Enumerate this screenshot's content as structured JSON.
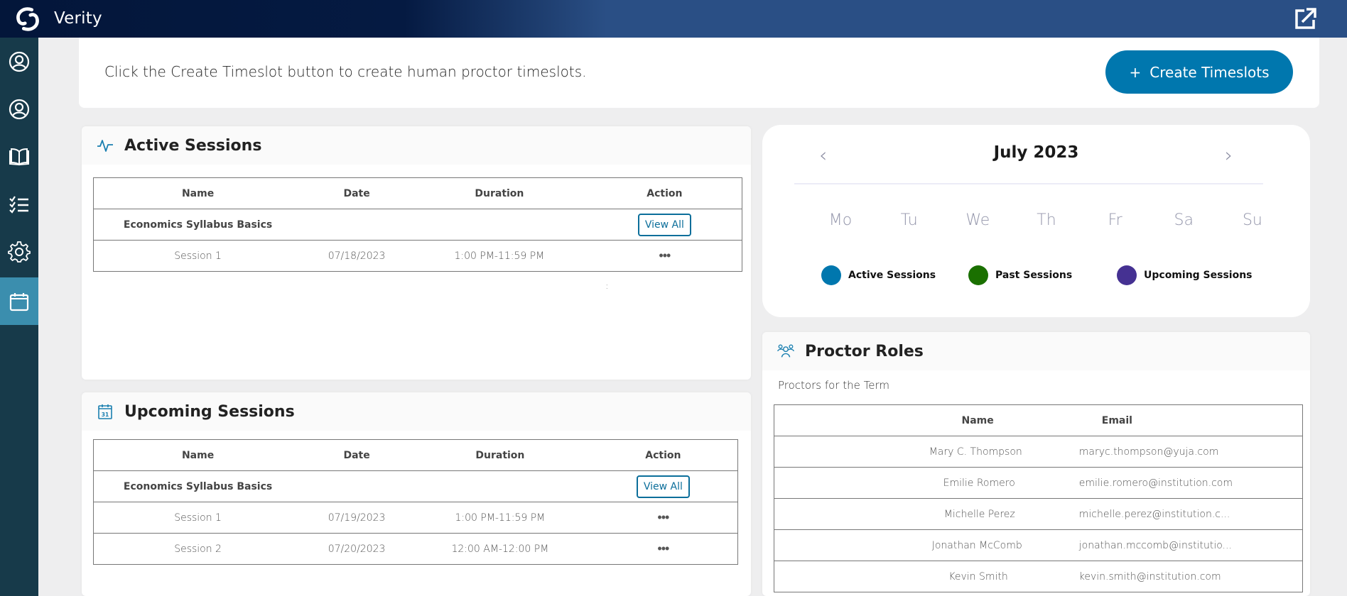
{
  "app": {
    "title": "Verity",
    "logo_icon": "verity-logo-icon",
    "external_link_icon": "external-link-icon"
  },
  "colors": {
    "brand_primary": "#0077ae",
    "sidebar_bg": "#173a4a",
    "sidebar_active": "#3b8eae",
    "header_dark": "#03163a",
    "header_light": "#2a4f85",
    "legend_active": "#0077ae",
    "legend_past": "#1a7000",
    "legend_upcoming": "#453192"
  },
  "sidebar": {
    "items": [
      {
        "icon": "user-circle-icon",
        "active": false
      },
      {
        "icon": "user-circle-icon",
        "active": false
      },
      {
        "icon": "book-open-icon",
        "active": false
      },
      {
        "icon": "checklist-icon",
        "active": false
      },
      {
        "icon": "gear-icon",
        "active": false
      },
      {
        "icon": "calendar-icon",
        "active": true
      }
    ]
  },
  "banner": {
    "message": "Click the Create Timeslot button to create human proctor timeslots.",
    "create_button_icon": "+",
    "create_button_label": "Create Timeslots"
  },
  "active_sessions": {
    "title": "Active Sessions",
    "icon": "activity-pulse-icon",
    "columns": [
      "Name",
      "Date",
      "Duration",
      "Action"
    ],
    "course": {
      "name": "Economics Syllabus Basics",
      "action_label": "View All"
    },
    "rows": [
      {
        "name": "Session 1",
        "date": "07/18/2023",
        "duration": "1:00 PM-11:59 PM",
        "action": "•••"
      }
    ]
  },
  "upcoming_sessions": {
    "title": "Upcoming Sessions",
    "icon": "calendar-31-icon",
    "columns": [
      "Name",
      "Date",
      "Duration",
      "Action"
    ],
    "course": {
      "name": "Economics Syllabus Basics",
      "action_label": "View All"
    },
    "rows": [
      {
        "name": "Session 1",
        "date": "07/19/2023",
        "duration": "1:00 PM-11:59 PM",
        "action": "•••"
      },
      {
        "name": "Session 2",
        "date": "07/20/2023",
        "duration": "12:00 AM-12:00 PM",
        "action": "•••"
      }
    ]
  },
  "calendar": {
    "month_label": "July 2023",
    "prev_icon": "‹",
    "next_icon": "›",
    "weekdays": [
      "Mo",
      "Tu",
      "We",
      "Th",
      "Fr",
      "Sa",
      "Su"
    ],
    "legend": [
      {
        "label": "Active Sessions",
        "color": "#0077ae"
      },
      {
        "label": "Past Sessions",
        "color": "#1a7000"
      },
      {
        "label": "Upcoming Sessions",
        "color": "#453192"
      }
    ]
  },
  "proctor_roles": {
    "title": "Proctor Roles",
    "icon": "users-group-icon",
    "subtitle": "Proctors for the Term",
    "columns": [
      "Name",
      "Email"
    ],
    "rows": [
      {
        "name": "Mary C. Thompson",
        "email": "maryc.thompson@yuja.com"
      },
      {
        "name": "Emilie Romero",
        "email": "emilie.romero@institution.com"
      },
      {
        "name": "Michelle Perez",
        "email": "michelle.perez@institution.c..."
      },
      {
        "name": "Jonathan McComb",
        "email": "jonathan.mccomb@institutio..."
      },
      {
        "name": "Kevin Smith",
        "email": "kevin.smith@institution.com"
      }
    ]
  }
}
